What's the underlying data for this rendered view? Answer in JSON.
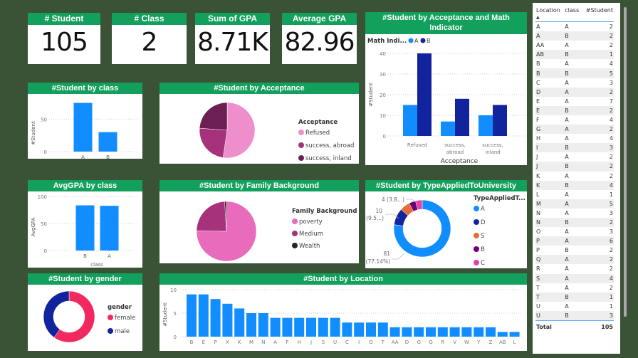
{
  "kpis": [
    {
      "title": "# Student",
      "value": "105"
    },
    {
      "title": "# Class",
      "value": "2"
    },
    {
      "title": "Sum of GPA",
      "value": "8.71K"
    },
    {
      "title": "Average GPA",
      "value": "82.96"
    }
  ],
  "colors": {
    "title_bar": "#12a05c",
    "background": "#3a5236",
    "bar_blue": "#118dff",
    "bar_dark_blue": "#12239e"
  },
  "chart_data": [
    {
      "id": "student_by_class",
      "type": "bar",
      "title": "#Student by class",
      "xlabel": "",
      "ylabel": "#Student",
      "categories": [
        "A",
        "B"
      ],
      "values": [
        75,
        30
      ],
      "yticks": [
        0,
        50
      ],
      "ylim": [
        0,
        80
      ]
    },
    {
      "id": "avggpa_by_class",
      "type": "bar",
      "title": "AvgGPA by class",
      "xlabel": "class",
      "ylabel": "AvgGPA",
      "categories": [
        "B",
        "A"
      ],
      "values": [
        83.5,
        82.7
      ],
      "yticks": [
        0,
        50,
        100
      ],
      "ylim": [
        0,
        100
      ]
    },
    {
      "id": "student_by_acceptance",
      "type": "pie",
      "title": "#Student by Acceptance",
      "legend_title": "Acceptance",
      "labels": [
        "Refused",
        "success, abroad",
        "success, inland"
      ],
      "values": [
        55,
        25,
        25
      ],
      "colors": [
        "#ee8fcb",
        "#a5327a",
        "#6b1f52"
      ]
    },
    {
      "id": "student_by_family",
      "type": "pie",
      "title": "#Student by Family Background",
      "legend_title": "Family Background",
      "labels": [
        "poverty",
        "Medium",
        "Wealth"
      ],
      "values": [
        79,
        25,
        1
      ],
      "colors": [
        "#e86cbb",
        "#a5327a",
        "#252423"
      ]
    },
    {
      "id": "student_by_acceptance_math",
      "type": "bar",
      "title": "#Student by Acceptance and Math Indicator",
      "legend_title": "Math Indi...",
      "xlabel": "Acceptance",
      "ylabel": "#Student",
      "categories": [
        "Refused",
        "success, abroad",
        "success, inland"
      ],
      "category_lines": [
        [
          "Refused"
        ],
        [
          "success,",
          "abroad"
        ],
        [
          "success,",
          "inland"
        ]
      ],
      "series": [
        {
          "name": "A",
          "values": [
            15,
            7,
            10
          ],
          "color": "#118dff"
        },
        {
          "name": "B",
          "values": [
            40,
            18,
            15
          ],
          "color": "#12239e"
        }
      ],
      "yticks": [
        0,
        10,
        20,
        30,
        40
      ],
      "ylim": [
        0,
        40
      ]
    },
    {
      "id": "student_by_type_applied",
      "type": "pie",
      "donut": true,
      "title": "#Student by TypeAppliedToUniversity",
      "legend_title": "TypeAppliedT...",
      "labels": [
        "A",
        "D",
        "S",
        "B",
        "C"
      ],
      "values": [
        81,
        10,
        6,
        4,
        4
      ],
      "colors": [
        "#118dff",
        "#12239e",
        "#e66c37",
        "#6b007b",
        "#e044a7"
      ],
      "data_labels": [
        {
          "line1": "81",
          "line2": "(77.14%)"
        },
        {
          "line1": "10",
          "line2": "(9.5...)"
        },
        {
          "line1": "4 (3.8...)",
          "line2": ""
        }
      ]
    },
    {
      "id": "student_by_gender",
      "type": "pie",
      "donut": true,
      "title": "#Student by gender",
      "legend_title": "gender",
      "labels": [
        "female",
        "male"
      ],
      "values": [
        63,
        42
      ],
      "colors": [
        "#f2295e",
        "#12239e"
      ]
    },
    {
      "id": "student_by_location",
      "type": "bar",
      "title": "#Student by Location",
      "xlabel": "",
      "ylabel": "#Student",
      "categories": [
        "B",
        "E",
        "P",
        "X",
        "K",
        "M",
        "N",
        "A",
        "F",
        "H",
        "J",
        "S",
        "U",
        "C",
        "I",
        "O",
        "T",
        "AA",
        "D",
        "G",
        "Q",
        "R",
        "V",
        "W",
        "Y",
        "Z",
        "AB",
        "L"
      ],
      "values": [
        9,
        9,
        8,
        7,
        6,
        5,
        5,
        4,
        4,
        4,
        4,
        4,
        4,
        3,
        3,
        3,
        3,
        2,
        2,
        2,
        2,
        2,
        2,
        2,
        2,
        2,
        1,
        1
      ],
      "yticks": [
        0,
        5,
        10
      ],
      "ylim": [
        0,
        10
      ]
    }
  ],
  "table": {
    "headers": [
      "Location",
      "class",
      "#Student"
    ],
    "sort_indicator": "▲",
    "rows": [
      [
        "A",
        "A",
        "2"
      ],
      [
        "A",
        "B",
        "2"
      ],
      [
        "AA",
        "A",
        "2"
      ],
      [
        "AB",
        "B",
        "1"
      ],
      [
        "B",
        "A",
        "4"
      ],
      [
        "B",
        "B",
        "5"
      ],
      [
        "C",
        "A",
        "3"
      ],
      [
        "D",
        "A",
        "2"
      ],
      [
        "E",
        "A",
        "7"
      ],
      [
        "E",
        "B",
        "2"
      ],
      [
        "F",
        "A",
        "4"
      ],
      [
        "G",
        "A",
        "2"
      ],
      [
        "H",
        "A",
        "4"
      ],
      [
        "I",
        "B",
        "3"
      ],
      [
        "J",
        "A",
        "2"
      ],
      [
        "J",
        "B",
        "2"
      ],
      [
        "K",
        "A",
        "2"
      ],
      [
        "K",
        "B",
        "4"
      ],
      [
        "L",
        "A",
        "1"
      ],
      [
        "M",
        "A",
        "5"
      ],
      [
        "N",
        "A",
        "3"
      ],
      [
        "N",
        "B",
        "2"
      ],
      [
        "O",
        "A",
        "3"
      ],
      [
        "P",
        "A",
        "6"
      ],
      [
        "P",
        "B",
        "2"
      ],
      [
        "Q",
        "A",
        "2"
      ],
      [
        "R",
        "A",
        "2"
      ],
      [
        "S",
        "A",
        "4"
      ],
      [
        "T",
        "A",
        "2"
      ],
      [
        "T",
        "B",
        "1"
      ],
      [
        "U",
        "A",
        "1"
      ],
      [
        "U",
        "B",
        "3"
      ]
    ],
    "total_label": "Total",
    "total_value": "105"
  }
}
